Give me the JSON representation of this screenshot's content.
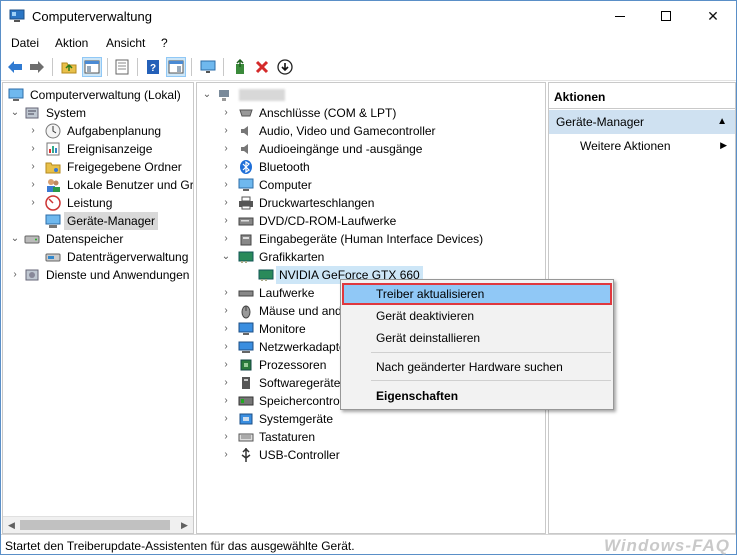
{
  "window": {
    "title": "Computerverwaltung",
    "minimize_glyph": "",
    "close_glyph": "✕"
  },
  "menu": [
    "Datei",
    "Aktion",
    "Ansicht",
    "?"
  ],
  "left_tree": [
    {
      "label": "Computerverwaltung (Lokal)",
      "icon": "computer-management-icon"
    },
    {
      "label": "System",
      "icon": "system-tools-icon"
    },
    {
      "label": "Aufgabenplanung",
      "icon": "task-scheduler-icon"
    },
    {
      "label": "Ereignisanzeige",
      "icon": "event-viewer-icon"
    },
    {
      "label": "Freigegebene Ordner",
      "icon": "shared-folders-icon"
    },
    {
      "label": "Lokale Benutzer und Gr",
      "icon": "local-users-icon"
    },
    {
      "label": "Leistung",
      "icon": "performance-icon"
    },
    {
      "label": "Geräte-Manager",
      "icon": "device-manager-icon"
    },
    {
      "label": "Datenspeicher",
      "icon": "storage-icon"
    },
    {
      "label": "Datenträgerverwaltung",
      "icon": "disk-management-icon"
    },
    {
      "label": "Dienste und Anwendungen",
      "icon": "services-icon"
    }
  ],
  "device_tree": {
    "root_label": "",
    "items": [
      {
        "label": "Anschlüsse (COM & LPT)",
        "icon": "ports-icon"
      },
      {
        "label": "Audio, Video und Gamecontroller",
        "icon": "audio-icon"
      },
      {
        "label": "Audioeingänge und -ausgänge",
        "icon": "audio-io-icon"
      },
      {
        "label": "Bluetooth",
        "icon": "bluetooth-icon"
      },
      {
        "label": "Computer",
        "icon": "computer-icon"
      },
      {
        "label": "Druckwarteschlangen",
        "icon": "printer-icon"
      },
      {
        "label": "DVD/CD-ROM-Laufwerke",
        "icon": "dvd-icon"
      },
      {
        "label": "Eingabegeräte (Human Interface Devices)",
        "icon": "hid-icon"
      },
      {
        "label": "Grafikkarten",
        "icon": "display-adapter-icon"
      },
      {
        "label": "NVIDIA GeForce GTX 660",
        "icon": "gpu-icon"
      },
      {
        "label": "Laufwerke",
        "icon": "disk-drive-icon"
      },
      {
        "label": "Mäuse und and",
        "icon": "mouse-icon"
      },
      {
        "label": "Monitore",
        "icon": "monitor-icon"
      },
      {
        "label": "Netzwerkadapte",
        "icon": "network-icon"
      },
      {
        "label": "Prozessoren",
        "icon": "processor-icon"
      },
      {
        "label": "Softwaregeräte",
        "icon": "software-device-icon"
      },
      {
        "label": "Speichercontro",
        "icon": "storage-controller-icon"
      },
      {
        "label": "Systemgeräte",
        "icon": "system-device-icon"
      },
      {
        "label": "Tastaturen",
        "icon": "keyboard-icon"
      },
      {
        "label": "USB-Controller",
        "icon": "usb-icon"
      }
    ]
  },
  "actions": {
    "header": "Aktionen",
    "section": "Geräte-Manager",
    "more": "Weitere Aktionen"
  },
  "context_menu": {
    "items": [
      "Treiber aktualisieren",
      "Gerät deaktivieren",
      "Gerät deinstallieren",
      "Nach geänderter Hardware suchen",
      "Eigenschaften"
    ]
  },
  "status": {
    "text": "Startet den Treiberupdate-Assistenten für das ausgewählte Gerät.",
    "watermark": "Windows-FAQ"
  },
  "colors": {
    "highlight": "#90c8f6",
    "highlight_border": "#e0383e",
    "selection": "#cde6f7",
    "action_section": "#cfe1f1"
  }
}
